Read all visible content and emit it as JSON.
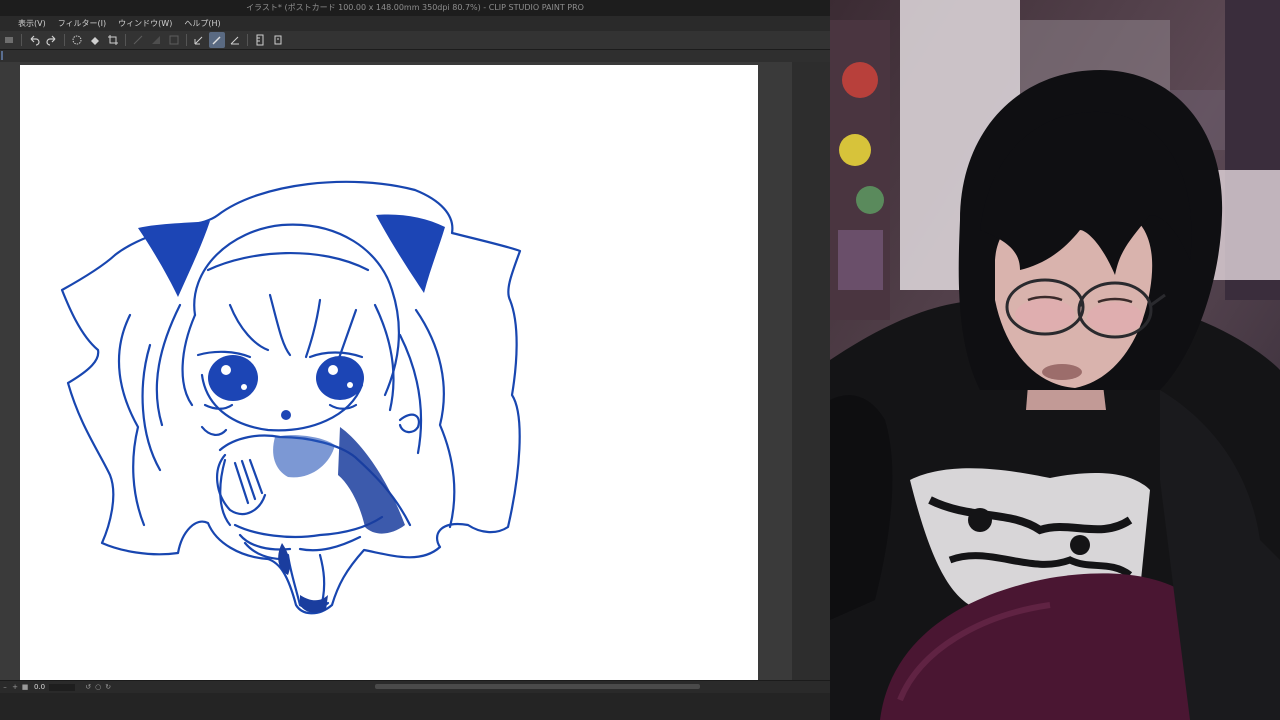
{
  "app": {
    "title": "イラスト* (ポストカード 100.00 x 148.00mm 350dpi 80.7%) - CLIP STUDIO PAINT PRO",
    "menu": [
      {
        "label": "表示(V)"
      },
      {
        "label": "フィルター(I)"
      },
      {
        "label": "ウィンドウ(W)"
      },
      {
        "label": "ヘルプ(H)"
      }
    ],
    "toolbar": {
      "icons": [
        "undo-icon",
        "redo-icon",
        "clear-icon",
        "fill-icon",
        "crop-icon",
        "transform-icon",
        "stabilizer-icon",
        "pen-line-icon",
        "pen-curve-icon",
        "pen-straight-icon",
        "ruler-icon",
        "snap-icon"
      ]
    },
    "status": {
      "zoom": "0.0"
    },
    "colors": {
      "chrome": "#2b2b2b",
      "canvas": "#ffffff",
      "sketch_ink": "#1846b0",
      "sketch_fill": "#1c45b5"
    }
  },
  "webcam": {
    "description_colors": {
      "hoodie": "#141416",
      "pillow": "#4a1632",
      "skin": "#d9b3ad",
      "hair": "#0f0f12"
    }
  }
}
